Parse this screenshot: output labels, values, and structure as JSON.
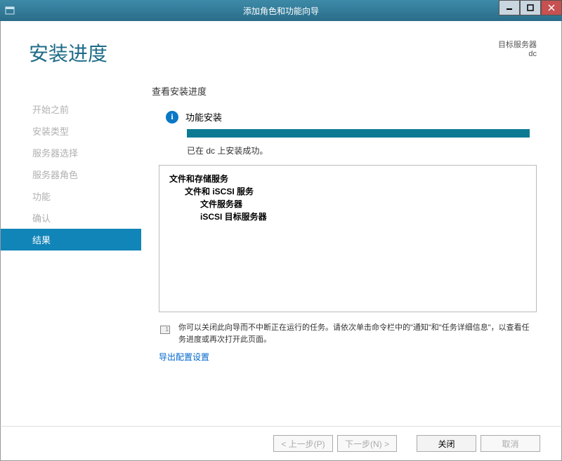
{
  "window": {
    "title": "添加角色和功能向导"
  },
  "header": {
    "page_title": "安装进度",
    "target_label": "目标服务器",
    "target_value": "dc"
  },
  "sidebar": {
    "items": [
      {
        "label": "开始之前"
      },
      {
        "label": "安装类型"
      },
      {
        "label": "服务器选择"
      },
      {
        "label": "服务器角色"
      },
      {
        "label": "功能"
      },
      {
        "label": "确认"
      },
      {
        "label": "结果"
      }
    ],
    "active_index": 6
  },
  "main": {
    "section_heading": "查看安装进度",
    "install_label": "功能安装",
    "success_text": "已在 dc 上安装成功。",
    "tree": [
      {
        "level": 0,
        "text": "文件和存储服务"
      },
      {
        "level": 1,
        "text": "文件和 iSCSI 服务"
      },
      {
        "level": 2,
        "text": "文件服务器"
      },
      {
        "level": 2,
        "text": "iSCSI 目标服务器"
      }
    ],
    "note_text": "你可以关闭此向导而不中断正在运行的任务。请依次单击命令栏中的\"通知\"和\"任务详细信息\"，以查看任务进度或再次打开此页面。",
    "export_link": "导出配置设置"
  },
  "footer": {
    "prev": "< 上一步(P)",
    "next": "下一步(N) >",
    "close": "关闭",
    "cancel": "取消"
  }
}
